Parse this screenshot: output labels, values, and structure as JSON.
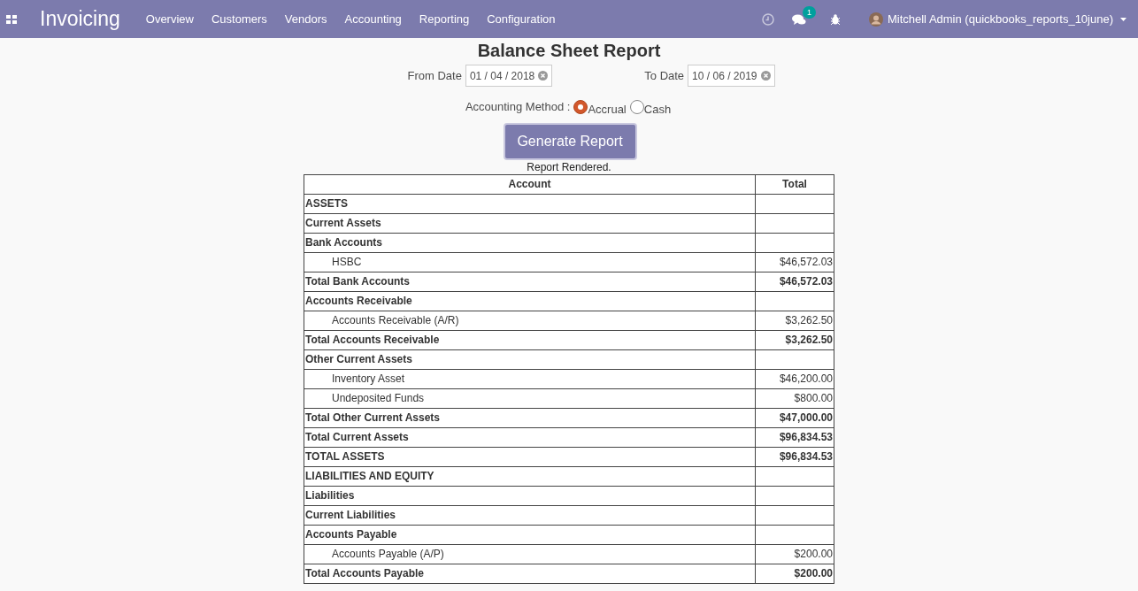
{
  "navbar": {
    "app_title": "Invoicing",
    "menu": [
      "Overview",
      "Customers",
      "Vendors",
      "Accounting",
      "Reporting",
      "Configuration"
    ],
    "messages_badge": "1",
    "user": "Mitchell Admin (quickbooks_reports_10june)"
  },
  "report": {
    "title": "Balance Sheet Report",
    "from_label": "From Date",
    "from_value": "01 / 04 / 2018",
    "to_label": "To Date",
    "to_value": "10 / 06 / 2019",
    "method_label": "Accounting Method :",
    "methods": [
      {
        "label": "Accrual",
        "selected": true
      },
      {
        "label": "Cash",
        "selected": false
      }
    ],
    "button": "Generate Report",
    "status": "Report Rendered."
  },
  "table": {
    "columns": [
      "Account",
      "Total"
    ],
    "rows": [
      {
        "kind": "header",
        "account": "ASSETS"
      },
      {
        "kind": "header",
        "account": "Current Assets"
      },
      {
        "kind": "header",
        "account": "Bank Accounts"
      },
      {
        "kind": "item",
        "account": "HSBC",
        "total": "$46,572.03"
      },
      {
        "kind": "total",
        "account": "Total Bank Accounts",
        "total": "$46,572.03"
      },
      {
        "kind": "header",
        "account": "Accounts Receivable"
      },
      {
        "kind": "item",
        "account": "Accounts Receivable (A/R)",
        "total": "$3,262.50"
      },
      {
        "kind": "total",
        "account": "Total Accounts Receivable",
        "total": "$3,262.50"
      },
      {
        "kind": "header",
        "account": "Other Current Assets"
      },
      {
        "kind": "item",
        "account": "Inventory Asset",
        "total": "$46,200.00"
      },
      {
        "kind": "item",
        "account": "Undeposited Funds",
        "total": "$800.00"
      },
      {
        "kind": "total",
        "account": "Total Other Current Assets",
        "total": "$47,000.00"
      },
      {
        "kind": "total",
        "account": "Total Current Assets",
        "total": "$96,834.53"
      },
      {
        "kind": "total",
        "account": "TOTAL ASSETS",
        "total": "$96,834.53"
      },
      {
        "kind": "header",
        "account": "LIABILITIES AND EQUITY"
      },
      {
        "kind": "header",
        "account": "Liabilities"
      },
      {
        "kind": "header",
        "account": "Current Liabilities"
      },
      {
        "kind": "header",
        "account": "Accounts Payable"
      },
      {
        "kind": "item",
        "account": "Accounts Payable (A/P)",
        "total": "$200.00"
      },
      {
        "kind": "total",
        "account": "Total Accounts Payable",
        "total": "$200.00"
      }
    ]
  }
}
